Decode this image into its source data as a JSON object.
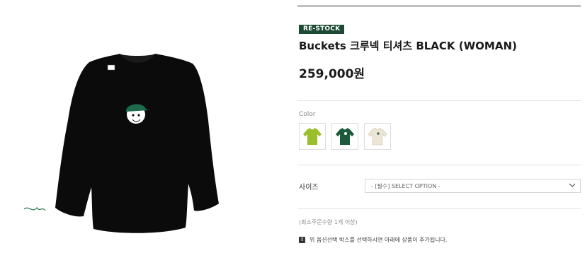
{
  "product": {
    "badge": "RE-STOCK",
    "title": "Buckets 크루넥 티셔츠 BLACK (WOMAN)",
    "price": "259,000원",
    "image_label": "sweatshirt-black"
  },
  "color": {
    "label": "Color",
    "options": [
      {
        "name": "lime",
        "hex": "#9bbf2a"
      },
      {
        "name": "green",
        "hex": "#1b5a3a"
      },
      {
        "name": "cream",
        "hex": "#ece6d6"
      }
    ]
  },
  "size": {
    "label": "사이즈",
    "select_value": "- [필수] SELECT OPTION -"
  },
  "footer": {
    "min_order": "(최소주문수량 1개 이상)",
    "notice": "위 옵션선택 박스를 선택하시면 아래에 상품이 추가됩니다.",
    "notice_icon": "!"
  },
  "colors": {
    "badge_bg": "#1d4a35",
    "garment": "#0b0b0b"
  }
}
